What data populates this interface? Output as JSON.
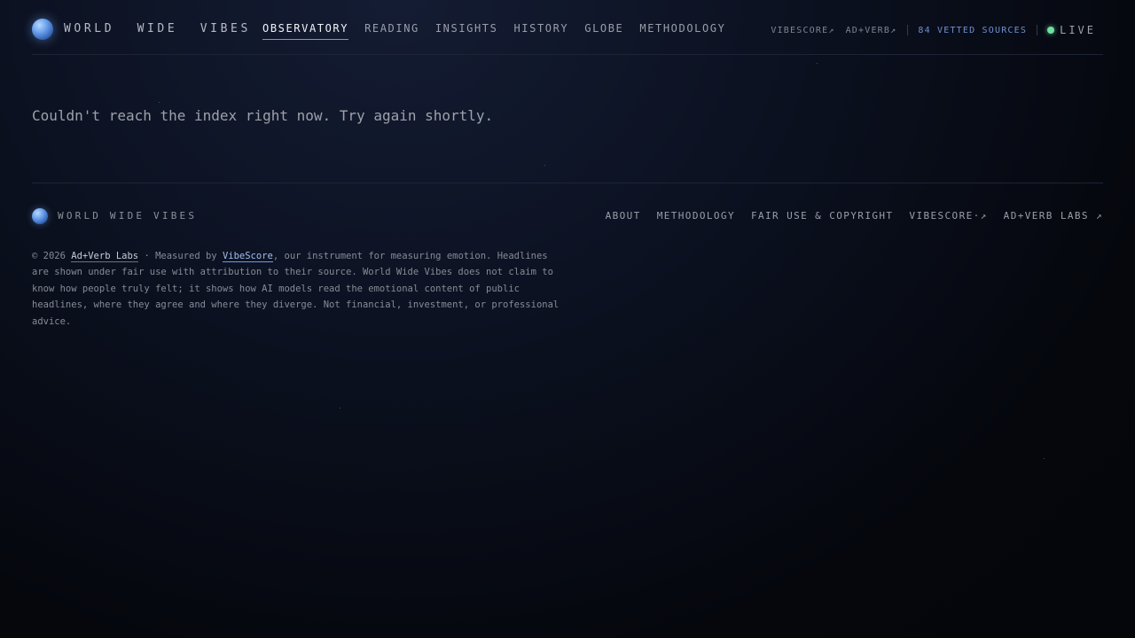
{
  "header": {
    "brand_words": [
      "WORLD",
      "WIDE",
      "VIBES"
    ],
    "nav": [
      {
        "label": "OBSERVATORY",
        "active": true
      },
      {
        "label": "READING",
        "active": false
      },
      {
        "label": "INSIGHTS",
        "active": false
      },
      {
        "label": "HISTORY",
        "active": false
      },
      {
        "label": "GLOBE",
        "active": false
      },
      {
        "label": "METHODOLOGY",
        "active": false
      }
    ],
    "vibescore_link": "VIBESCORE↗",
    "adverb_link": "AD+VERB↗",
    "sources": "84 VETTED SOURCES",
    "live": "LIVE"
  },
  "main": {
    "error_message": "Couldn't reach the index right now. Try again shortly."
  },
  "footer": {
    "brand": "WORLD WIDE VIBES",
    "nav": [
      "ABOUT",
      "METHODOLOGY",
      "FAIR USE & COPYRIGHT",
      "VIBESCORE·↗",
      "AD+VERB LABS ↗"
    ],
    "copyright_prefix": "© 2026 ",
    "company_link": "Ad+Verb Labs",
    "measured_by": " · Measured by ",
    "vibescore_link": "VibeScore",
    "disclaimer": ", our instrument for measuring emotion. Headlines are shown under fair use with attribution to their source. World Wide Vibes does not claim to know how people truly felt; it shows how AI models read the emotional content of public headlines, where they agree and where they diverge. Not financial, investment, or professional advice."
  },
  "colors": {
    "accent": "#6f98e8",
    "live_indicator": "#6fe0a0",
    "background": "#0c1222"
  }
}
